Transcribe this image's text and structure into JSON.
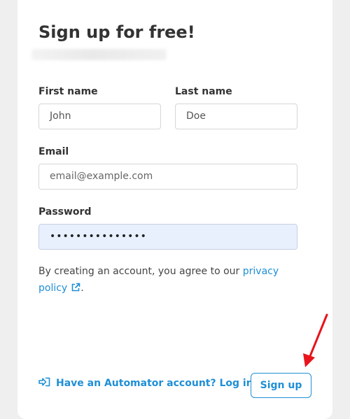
{
  "form": {
    "title": "Sign up for free!",
    "first_name_label": "First name",
    "first_name_value": "John",
    "last_name_label": "Last name",
    "last_name_value": "Doe",
    "email_label": "Email",
    "email_placeholder": "email@example.com",
    "password_label": "Password",
    "password_masked": "•••••••••••••••",
    "agreement_text": "By creating an account, you agree to our ",
    "privacy_link": "privacy policy",
    "agreement_end": ".",
    "login_link": "Have an Automator account? Log in",
    "signup_button": "Sign up"
  },
  "icons": {
    "external_link": "external-link-icon",
    "login": "login-icon",
    "annotation": "red-arrow"
  },
  "colors": {
    "accent": "#1f8fd6",
    "annotation": "#e8141b",
    "password_fill": "#e8f0fe"
  }
}
